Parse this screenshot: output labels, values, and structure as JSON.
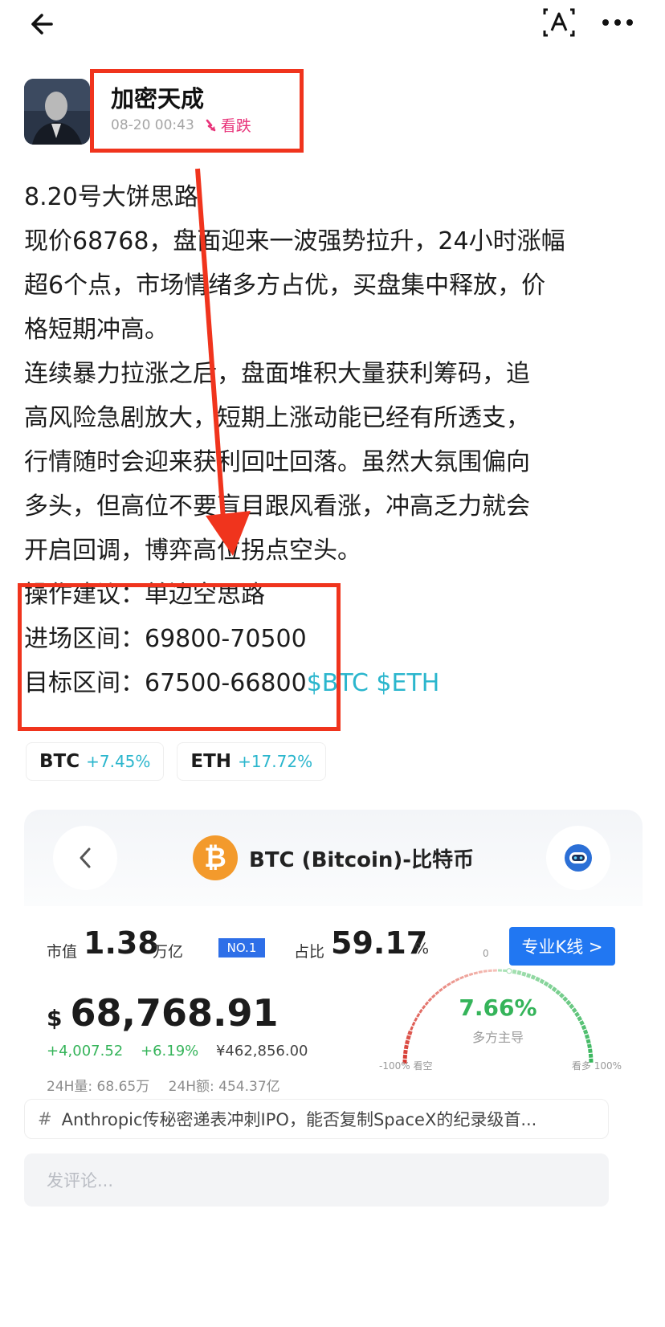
{
  "header": {
    "back_icon": "arrow-left-icon",
    "translate_icon": "translate-icon",
    "more_icon": "more-dots-icon"
  },
  "author": {
    "name": "加密天成",
    "time": "08-20 00:43",
    "sentiment": "看跌",
    "sentiment_color": "#e8347a"
  },
  "post": {
    "lines": [
      "8.20号大饼思路",
      "现价68768，盘面迎来一波强势拉升，24小时涨幅",
      "超6个点，市场情绪多方占优，买盘集中释放，价",
      "格短期冲高。",
      "连续暴力拉涨之后，盘面堆积大量获利筹码，追",
      "高风险急剧放大，短期上涨动能已经有所透支，",
      "行情随时会迎来获利回吐回落。虽然大氛围偏向",
      "多头，但高位不要盲目跟风看涨，冲高乏力就会",
      "开启回调，博弈高位拐点空头。",
      "操作建议：单边空思路",
      "进场区间：69800-70500"
    ],
    "last_line": "目标区间：67500-66800",
    "tags": "$BTC $ETH",
    "tag_color": "#2bb6cd"
  },
  "chips": [
    {
      "symbol": "BTC",
      "change": "+7.45%"
    },
    {
      "symbol": "ETH",
      "change": "+17.72%"
    }
  ],
  "coin": {
    "title": "BTC (Bitcoin)-比特币",
    "logo_glyph": "₿",
    "market_cap_label": "市值",
    "market_cap_value": "1.38",
    "market_cap_unit": "万亿",
    "rank": "NO.1",
    "share_label": "占比",
    "share_value": "59.17",
    "share_unit": "%",
    "kline_button": "专业K线 >",
    "currency": "$",
    "price": "68,768.91",
    "change_abs": "+4,007.52",
    "change_pct": "+6.19%",
    "price_cny": "¥462,856.00",
    "vol_24h": "24H量: 68.65万",
    "amount_24h": "24H额: 454.37亿",
    "gauge_zero": "0",
    "gauge_value": "7.66%",
    "gauge_fraction": 0.5383,
    "gauge_label": "多方主导",
    "gauge_left": "-100% 看空",
    "gauge_right": "看多 100%",
    "brand_blue": "#2177f2",
    "up_green": "#35b45a"
  },
  "topic": {
    "hash": "#",
    "text": "Anthropic传秘密递表冲刺IPO，能否复制SpaceX的纪录级首..."
  },
  "comment": {
    "placeholder": "发评论..."
  }
}
